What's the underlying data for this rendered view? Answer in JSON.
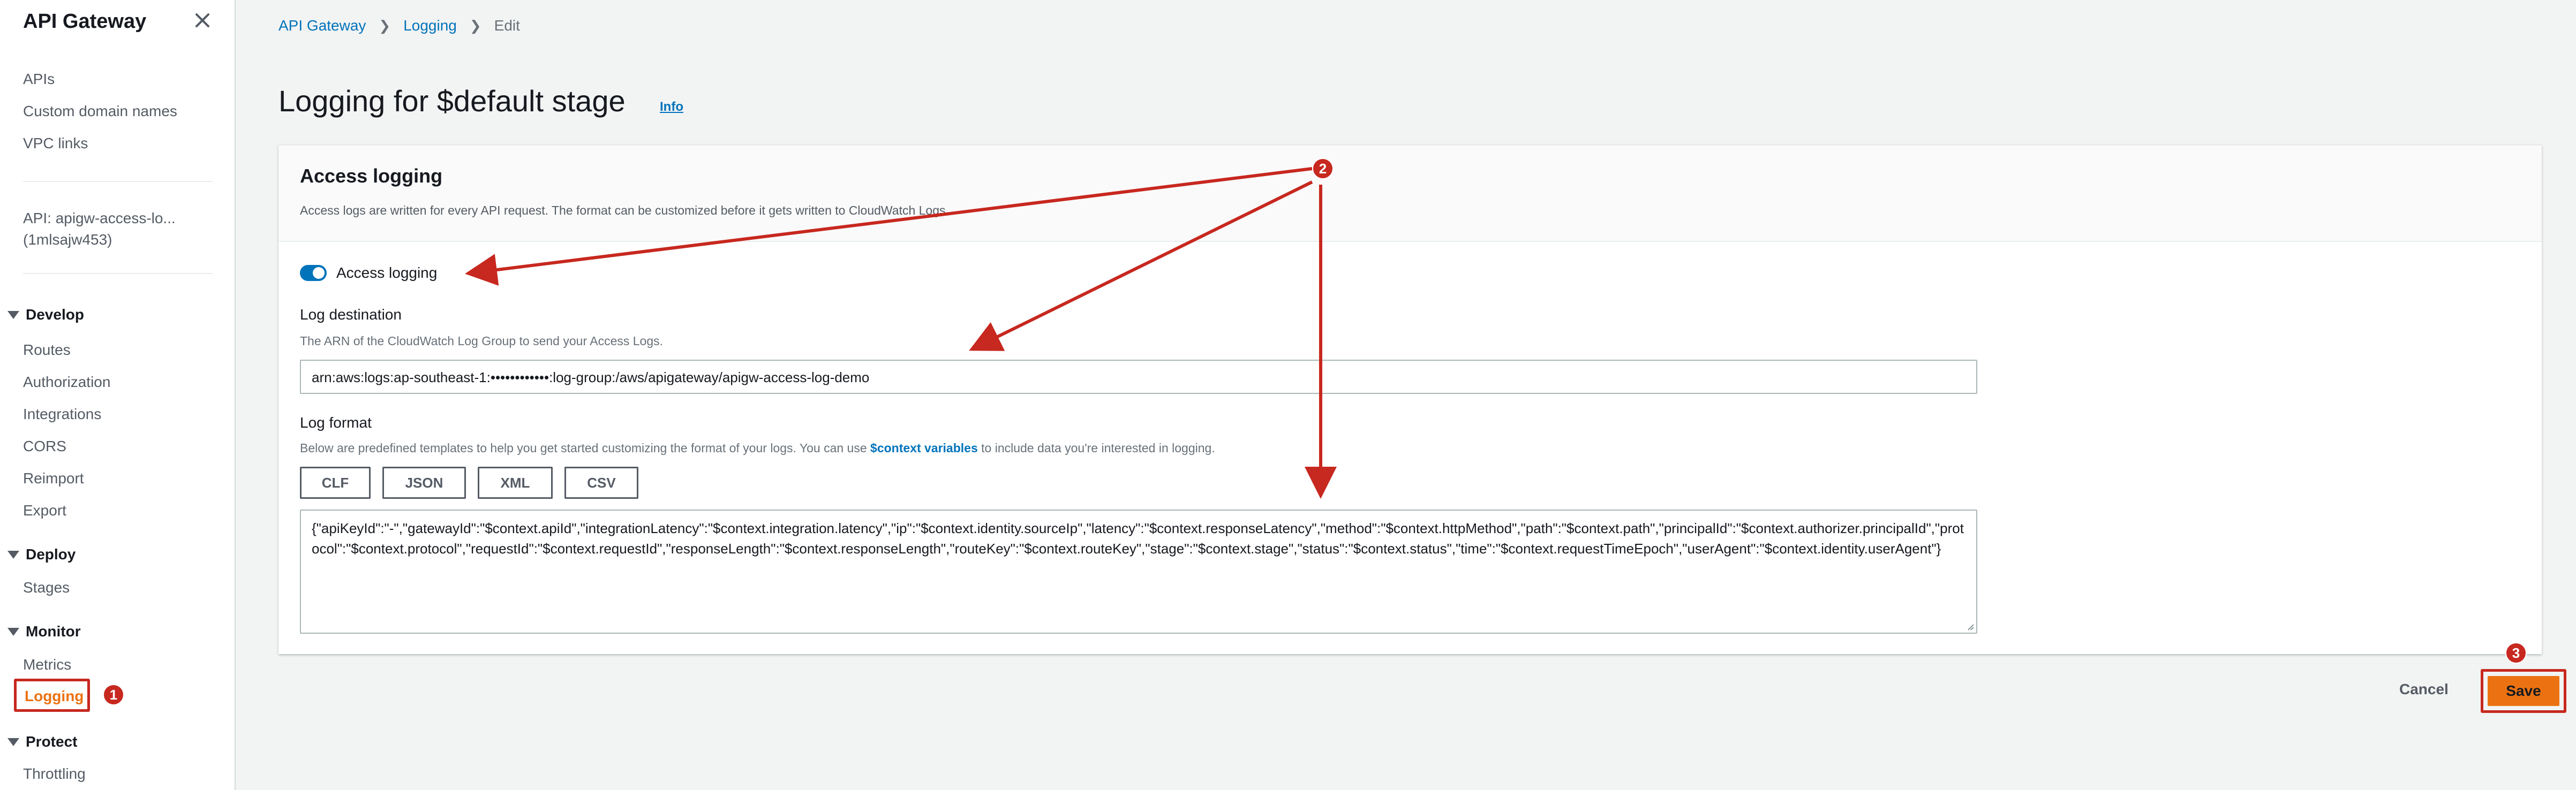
{
  "sidebar": {
    "title": "API Gateway",
    "top_links": [
      "APIs",
      "Custom domain names",
      "VPC links"
    ],
    "api_line1": "API: apigw-access-lo...",
    "api_line2": "(1mlsajw453)",
    "sections": [
      {
        "label": "Develop",
        "items": [
          "Routes",
          "Authorization",
          "Integrations",
          "CORS",
          "Reimport",
          "Export"
        ]
      },
      {
        "label": "Deploy",
        "items": [
          "Stages"
        ]
      },
      {
        "label": "Monitor",
        "items": [
          "Metrics",
          "Logging"
        ]
      },
      {
        "label": "Protect",
        "items": [
          "Throttling"
        ]
      }
    ],
    "active_item": "Logging"
  },
  "breadcrumb": [
    "API Gateway",
    "Logging",
    "Edit"
  ],
  "header": {
    "title": "Logging for $default stage",
    "info": "Info"
  },
  "panel": {
    "title": "Access logging",
    "description": "Access logs are written for every API request. The format can be customized before it gets written to CloudWatch Logs.",
    "toggle_label": "Access logging",
    "toggle_on": true,
    "destination_label": "Log destination",
    "destination_desc": "The ARN of the CloudWatch Log Group to send your Access Logs.",
    "destination_value": "arn:aws:logs:ap-southeast-1:••••••••••••:log-group:/aws/apigateway/apigw-access-log-demo",
    "format_label": "Log format",
    "format_desc_before": "Below are predefined templates to help you get started customizing the format of your logs. You can use ",
    "format_desc_link": "$context variables",
    "format_desc_after": " to include data you're interested in logging.",
    "format_buttons": [
      "CLF",
      "JSON",
      "XML",
      "CSV"
    ],
    "format_value": "{\"apiKeyId\":\"-\",\"gatewayId\":\"$context.apiId\",\"integrationLatency\":\"$context.integration.latency\",\"ip\":\"$context.identity.sourceIp\",\"latency\":\"$context.responseLatency\",\"method\":\"$context.httpMethod\",\"path\":\"$context.path\",\"principalId\":\"$context.authorizer.principalId\",\"protocol\":\"$context.protocol\",\"requestId\":\"$context.requestId\",\"responseLength\":\"$context.responseLength\",\"routeKey\":\"$context.routeKey\",\"stage\":\"$context.stage\",\"status\":\"$context.status\",\"time\":\"$context.requestTimeEpoch\",\"userAgent\":\"$context.identity.userAgent\"}"
  },
  "footer": {
    "cancel": "Cancel",
    "save": "Save"
  },
  "annotations": [
    "1",
    "2",
    "3"
  ],
  "colors": {
    "accent": "#ec7211",
    "link": "#0073bb",
    "annotation": "#c7281f"
  }
}
